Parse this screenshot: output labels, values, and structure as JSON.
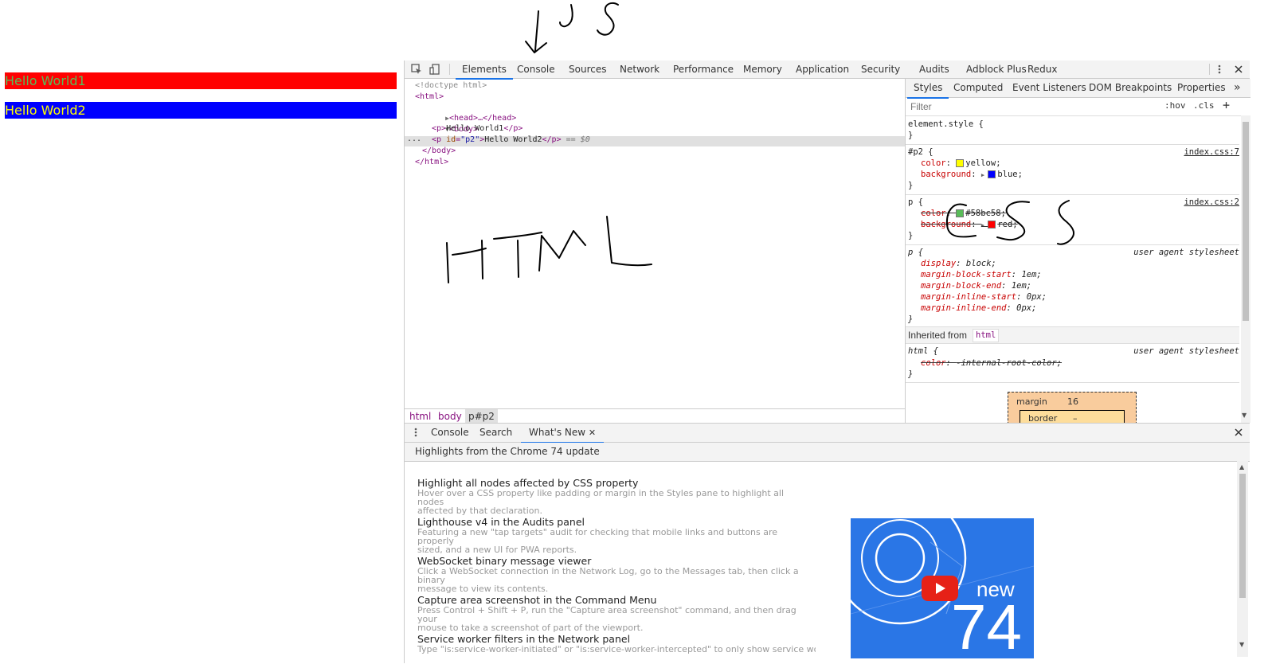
{
  "page": {
    "p1_text": "Hello World1",
    "p2_text": "Hello World2"
  },
  "devtools": {
    "main_tabs": [
      "Elements",
      "Console",
      "Sources",
      "Network",
      "Performance",
      "Memory",
      "Application",
      "Security",
      "Audits",
      "Adblock Plus",
      "Redux"
    ],
    "active_tab": "Elements",
    "icons": [
      "inspect-icon",
      "device-toolbar-icon",
      "more-options-icon",
      "close-icon"
    ],
    "elements_tree": {
      "doctype": "<!doctype html>",
      "html_open": "<html>",
      "head": "<head>…</head>",
      "body_open": "<body>",
      "p1_open": "<p>",
      "p1_text": "Hello World1",
      "p1_close": "</p>",
      "p2_open_tag": "<p ",
      "p2_attr": "id",
      "p2_attr_eq": "=",
      "p2_attr_val": "\"p2\"",
      "p2_gt": ">",
      "p2_text": "Hello World2",
      "p2_close": "</p>",
      "p2_marker": " == $0",
      "ellipsis": "...",
      "body_close": "</body>",
      "html_close": "</html>"
    },
    "breadcrumbs": [
      "html",
      "body",
      "p#p2"
    ],
    "styles_tabs": [
      "Styles",
      "Computed",
      "Event Listeners",
      "DOM Breakpoints",
      "Properties"
    ],
    "styles_more": "»",
    "filter_placeholder": "Filter",
    "hov_label": ":hov",
    "cls_label": ".cls",
    "plus_label": "+",
    "rules": {
      "element_style": {
        "open": "element.style {",
        "close": "}"
      },
      "p2": {
        "selector": "#p2 {",
        "source": "index.css:7",
        "color_prop": "color",
        "color_val": "yellow",
        "bg_prop": "background",
        "bg_val": "blue",
        "close": "}"
      },
      "p": {
        "selector": "p {",
        "source": "index.css:2",
        "color_prop": "color",
        "color_val": "#58bc58",
        "bg_prop": "background",
        "bg_val": "red",
        "close": "}"
      },
      "ua_p": {
        "selector": "p {",
        "source": "user agent stylesheet",
        "lines": [
          {
            "prop": "display",
            "val": "block"
          },
          {
            "prop": "margin-block-start",
            "val": "1em"
          },
          {
            "prop": "margin-block-end",
            "val": "1em"
          },
          {
            "prop": "margin-inline-start",
            "val": "0px"
          },
          {
            "prop": "margin-inline-end",
            "val": "0px"
          }
        ],
        "close": "}"
      },
      "inherited_label": "Inherited from",
      "inherited_from": "html",
      "ua_html": {
        "selector": "html {",
        "source": "user agent stylesheet",
        "prop": "color",
        "val": "-internal-root-color",
        "close": "}"
      }
    },
    "box_model": {
      "margin_label": "margin",
      "margin_val": "16",
      "border_label": "border",
      "border_val": "–"
    },
    "colors": {
      "p1_bg": "#ff0000",
      "p1_fg": "#58bc58",
      "p2_bg": "#0000ff",
      "p2_fg": "#ffff00",
      "accent": "#1a73e8",
      "tag": "#881280",
      "prop": "#c80000"
    },
    "drawer": {
      "tabs": [
        "Console",
        "Search",
        "What's New"
      ],
      "active_tab": "What's New",
      "highlights_header": "Highlights from the Chrome 74 update",
      "items": [
        {
          "title": "Highlight all nodes affected by CSS property",
          "desc_1": "Hover over a CSS property like padding or margin in the Styles pane to highlight all nodes",
          "desc_2": "affected by that declaration."
        },
        {
          "title": "Lighthouse v4 in the Audits panel",
          "desc_1": "Featuring a new \"tap targets\" audit for checking that mobile links and buttons are properly",
          "desc_2": "sized, and a new UI for PWA reports."
        },
        {
          "title": "WebSocket binary message viewer",
          "desc_1": "Click a WebSocket connection in the Network Log, go to the Messages tab, then click a binary",
          "desc_2": "message to view its contents."
        },
        {
          "title": "Capture area screenshot in the Command Menu",
          "desc_1": "Press Control + Shift + P, run the \"Capture area screenshot\" command, and then drag your",
          "desc_2": "mouse to take a screenshot of part of the viewport."
        },
        {
          "title": "Service worker filters in the Network panel",
          "desc_1": "Type \"is:service-worker-initiated\" or \"is:service-worker-intercepted\" to only show service worker",
          "desc_2": ""
        }
      ],
      "video_new": "new",
      "video_num": "74"
    }
  }
}
